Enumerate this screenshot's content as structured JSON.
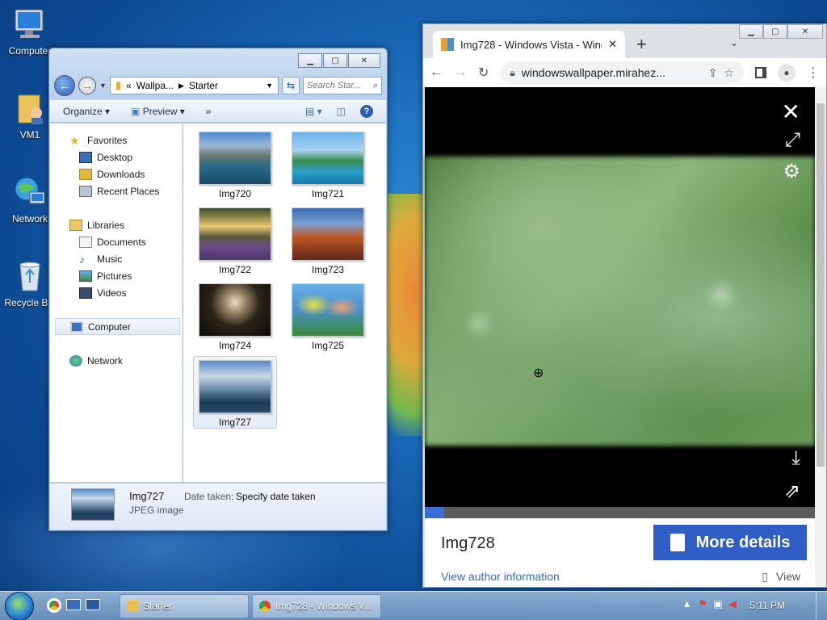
{
  "desktop": {
    "icons": [
      {
        "label": "Computer"
      },
      {
        "label": "VM1"
      },
      {
        "label": "Network"
      },
      {
        "label": "Recycle Bin"
      }
    ]
  },
  "explorer": {
    "address": {
      "part1": "Wallpa...",
      "part2": "Starter"
    },
    "search_placeholder": "Search Star...",
    "toolbar": {
      "organize": "Organize",
      "preview": "Preview",
      "more": "»"
    },
    "nav": {
      "favorites": "Favorites",
      "desktop": "Desktop",
      "downloads": "Downloads",
      "recent": "Recent Places",
      "libraries": "Libraries",
      "documents": "Documents",
      "music": "Music",
      "pictures": "Pictures",
      "videos": "Videos",
      "computer": "Computer",
      "network": "Network"
    },
    "files": [
      {
        "name": "Img720"
      },
      {
        "name": "Img721"
      },
      {
        "name": "Img722"
      },
      {
        "name": "Img723"
      },
      {
        "name": "Img724"
      },
      {
        "name": "Img725"
      },
      {
        "name": "Img727"
      }
    ],
    "details": {
      "name": "Img727",
      "type": "JPEG image",
      "date_label": "Date taken:",
      "date_value": "Specify date taken"
    }
  },
  "chrome": {
    "tab_title": "Img728 - Windows Vista - Windo",
    "new_tab": "+",
    "url": "windowswallpaper.mirahez...",
    "image_title": "Img728",
    "more_details": "More details",
    "author_link": "View author information",
    "view_label": "View",
    "progress": 0.05
  },
  "taskbar": {
    "tasks": [
      {
        "label": "Starter"
      },
      {
        "label": "Img728 - Windows V..."
      }
    ],
    "time": "5:11 PM"
  }
}
